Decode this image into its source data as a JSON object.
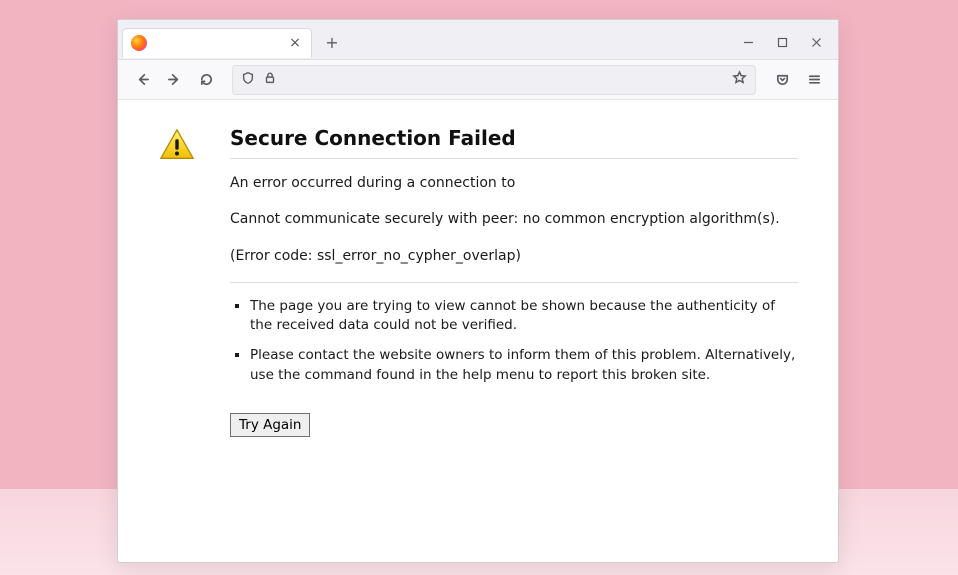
{
  "tabstrip": {
    "active_tab_title": "",
    "close_glyph": "×",
    "newtab_glyph": "+"
  },
  "urlbar": {
    "value": "",
    "placeholder": ""
  },
  "error": {
    "title": "Secure Connection Failed",
    "line1": "An error occurred during a connection to",
    "line2": "Cannot communicate securely with peer: no common encryption algorithm(s).",
    "code_line": "(Error code: ssl_error_no_cypher_overlap)",
    "bullets": [
      "The page you are trying to view cannot be shown because the authenticity of the received data could not be verified.",
      "Please contact the website owners to inform them of this problem. Alternatively, use the command found in the help menu to report this broken site."
    ],
    "try_again_label": "Try Again"
  }
}
